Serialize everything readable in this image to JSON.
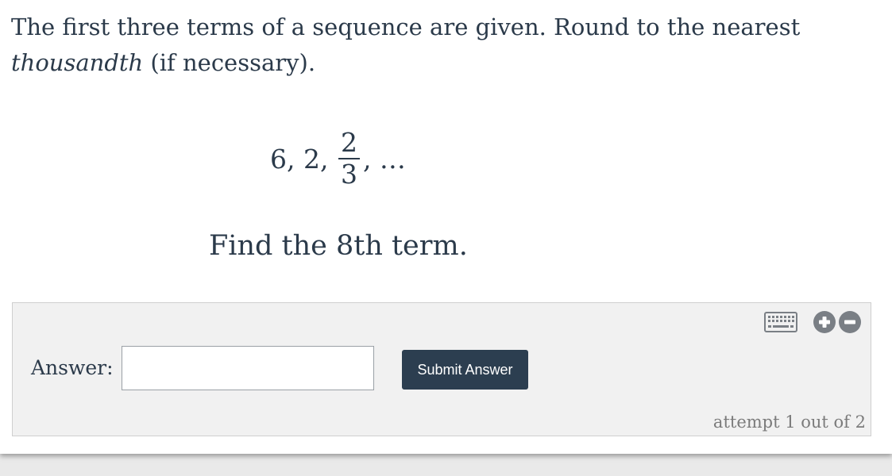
{
  "prompt": {
    "line1": "The first three terms of a sequence are given. Round to the nearest",
    "emphasis": "thousandth",
    "line2_rest": " (if necessary)."
  },
  "sequence": {
    "lead_terms": "6, 2, ",
    "fraction_numerator": "2",
    "fraction_denominator": "3",
    "trailing": ", …"
  },
  "question": "Find the 8th term.",
  "answer": {
    "label": "Answer:",
    "input_value": "",
    "input_placeholder": "",
    "submit_label": "Submit Answer"
  },
  "toolbar": {
    "icons": [
      "keyboard-icon",
      "zoom-in-icon",
      "zoom-out-icon"
    ]
  },
  "attempt_text": "attempt 1 out of 2",
  "colors": {
    "text": "#2b3a4a",
    "panel_bg": "#f1f1f1",
    "button_bg": "#2c3e50",
    "icon_gray": "#7a7f85"
  }
}
